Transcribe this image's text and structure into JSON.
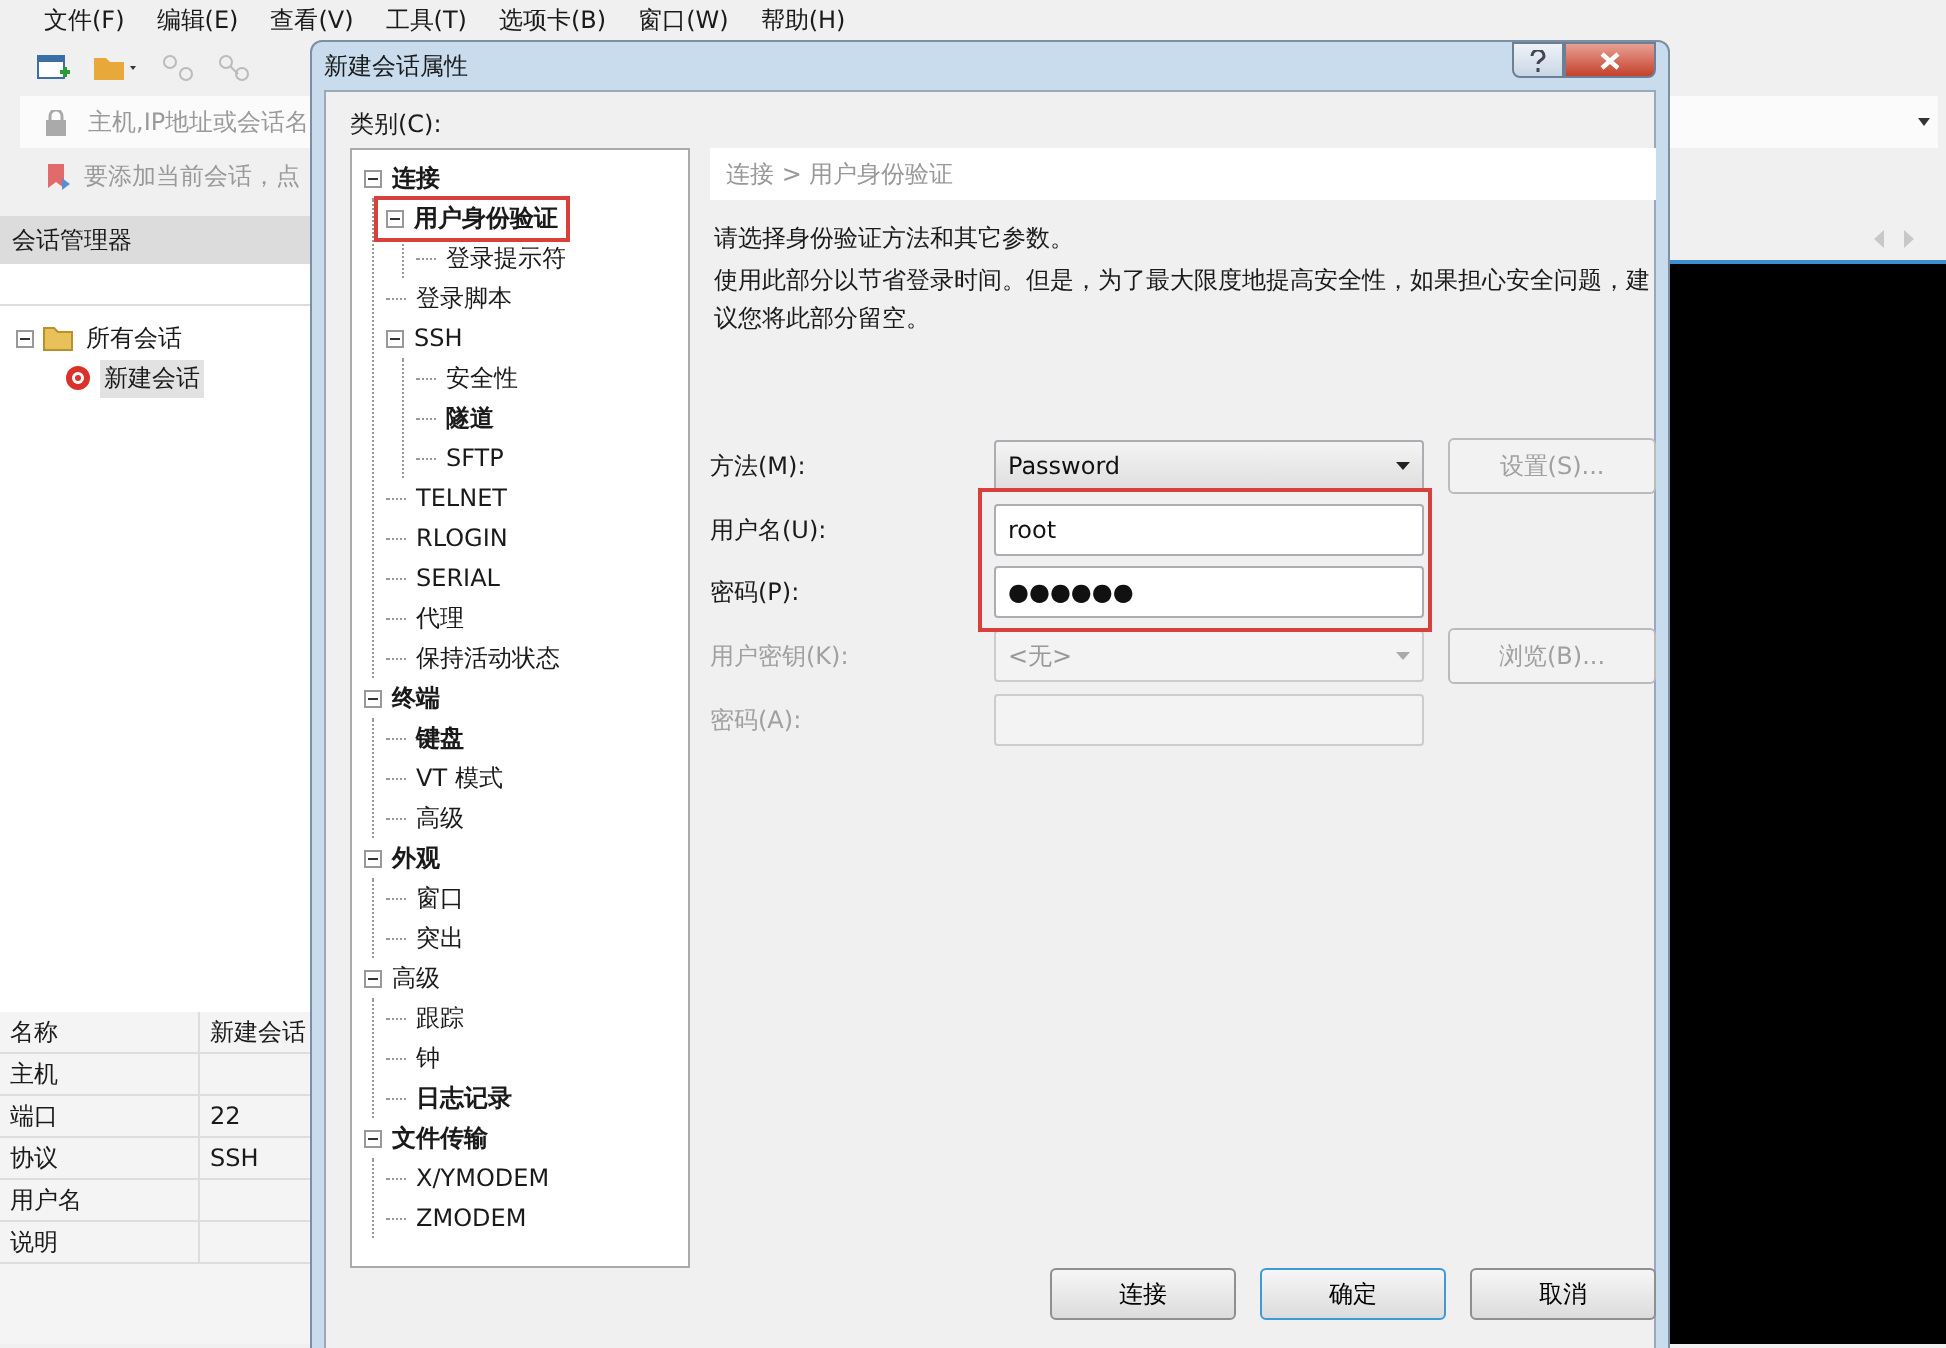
{
  "menu": [
    "文件(F)",
    "编辑(E)",
    "查看(V)",
    "工具(T)",
    "选项卡(B)",
    "窗口(W)",
    "帮助(H)"
  ],
  "address_bar": {
    "placeholder": "主机,IP地址或会话名"
  },
  "quick_bar": {
    "text": "要添加当前会话，点"
  },
  "session_manager": {
    "title": "会话管理器",
    "tree": [
      {
        "label": "所有会话",
        "expanded": true,
        "selected": false,
        "children": [
          {
            "label": "新建会话",
            "selected": true
          }
        ]
      }
    ]
  },
  "properties": [
    {
      "name": "名称",
      "value": "新建会话"
    },
    {
      "name": "主机"
    },
    {
      "name": "端口",
      "value": "22"
    },
    {
      "name": "协议",
      "value": "SSH"
    },
    {
      "name": "用户名"
    },
    {
      "name": "说明"
    }
  ],
  "dialog": {
    "title": "新建会话属性",
    "category_label": "类别(C):",
    "categories": [
      {
        "label": "连接",
        "bold": true,
        "expanded": true,
        "outlined": false,
        "children": [
          {
            "label": "用户身份验证",
            "bold": true,
            "expanded": true,
            "outlined": true,
            "children": [
              {
                "label": "登录提示符",
                "bold": false
              }
            ]
          },
          {
            "label": "登录脚本",
            "bold": false
          },
          {
            "label": "SSH",
            "bold": false,
            "expanded": true,
            "children": [
              {
                "label": "安全性",
                "bold": false
              },
              {
                "label": "隧道",
                "bold": true
              },
              {
                "label": "SFTP",
                "bold": false
              }
            ]
          },
          {
            "label": "TELNET",
            "bold": false
          },
          {
            "label": "RLOGIN",
            "bold": false
          },
          {
            "label": "SERIAL",
            "bold": false
          },
          {
            "label": "代理",
            "bold": false
          },
          {
            "label": "保持活动状态",
            "bold": false
          }
        ]
      },
      {
        "label": "终端",
        "bold": true,
        "expanded": true,
        "children": [
          {
            "label": "键盘",
            "bold": true
          },
          {
            "label": "VT 模式",
            "bold": false
          },
          {
            "label": "高级",
            "bold": false
          }
        ]
      },
      {
        "label": "外观",
        "bold": true,
        "expanded": true,
        "children": [
          {
            "label": "窗口",
            "bold": false
          },
          {
            "label": "突出",
            "bold": false
          }
        ]
      },
      {
        "label": "高级",
        "bold": false,
        "expanded": true,
        "children": [
          {
            "label": "跟踪",
            "bold": false
          },
          {
            "label": "钟",
            "bold": false
          },
          {
            "label": "日志记录",
            "bold": true
          }
        ]
      },
      {
        "label": "文件传输",
        "bold": true,
        "expanded": true,
        "children": [
          {
            "label": "X/YMODEM",
            "bold": false
          },
          {
            "label": "ZMODEM",
            "bold": false
          }
        ]
      }
    ],
    "breadcrumb": "连接 > 用户身份验证",
    "intro": "请选择身份验证方法和其它参数。",
    "note": "使用此部分以节省登录时间。但是，为了最大限度地提高安全性，如果担心安全问题，建议您将此部分留空。",
    "fields": [
      {
        "label": "方法(M):",
        "kind": "select",
        "value": "Password",
        "disabled": false,
        "button": "设置(S)...",
        "button_disabled": true,
        "outlined": false
      },
      {
        "label": "用户名(U):",
        "kind": "text",
        "value": "root",
        "disabled": false,
        "outlined": true
      },
      {
        "label": "密码(P):",
        "kind": "text",
        "value": "●●●●●●",
        "disabled": false,
        "outlined": true
      },
      {
        "label": "用户密钥(K):",
        "kind": "select",
        "value": "<无>",
        "disabled": true,
        "button": "浏览(B)...",
        "button_disabled": true,
        "outlined": false
      },
      {
        "label": "密码(A):",
        "kind": "text",
        "disabled": true,
        "outlined": false
      }
    ],
    "buttons": [
      {
        "label": "连接",
        "default": false
      },
      {
        "label": "确定",
        "default": true
      },
      {
        "label": "取消",
        "default": false
      }
    ]
  }
}
